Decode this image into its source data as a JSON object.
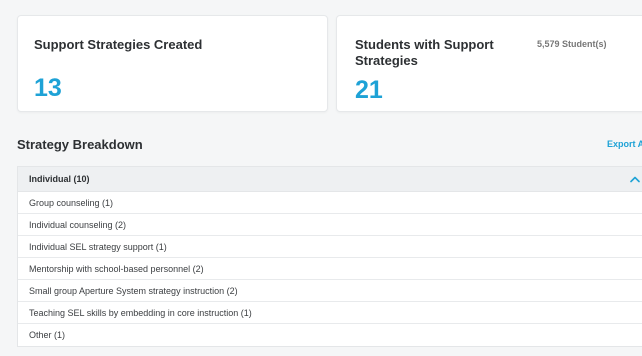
{
  "cards": {
    "strategies": {
      "title": "Support Strategies Created",
      "value": "13"
    },
    "students": {
      "title": "Students with Support Strategies",
      "value": "21",
      "aside": "5,579 Student(s)"
    }
  },
  "breakdown": {
    "title": "Strategy Breakdown",
    "export_label": "Export A",
    "group": {
      "label": "Individual (10)",
      "expanded": true
    },
    "rows": [
      "Group counseling (1)",
      "Individual counseling (2)",
      "Individual SEL strategy support (1)",
      "Mentorship with school-based personnel (2)",
      "Small group Aperture System strategy instruction (2)",
      "Teaching SEL skills by embedding in core instruction (1)",
      "Other (1)"
    ]
  },
  "colors": {
    "accent": "#1ea2d6",
    "header_bg": "#eef0f2"
  }
}
